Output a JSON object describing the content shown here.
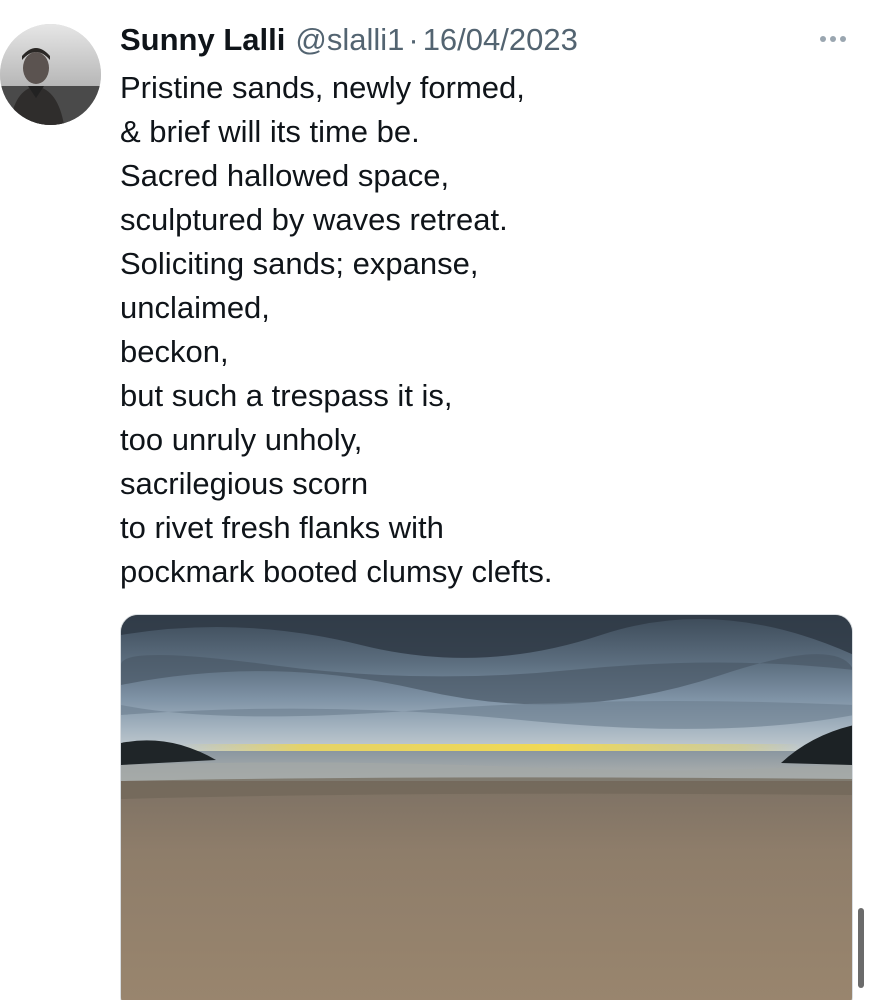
{
  "post": {
    "author": {
      "name": "Sunny Lalli",
      "handle": "@slalli1"
    },
    "separator": "·",
    "date": "16/04/2023",
    "text_lines": [
      "Pristine sands, newly formed,",
      "& brief will its time be.",
      "Sacred hallowed space,",
      "sculptured by waves retreat.",
      "Soliciting sands; expanse,",
      "unclaimed,",
      "beckon,",
      "but such a trespass it is,",
      "too unruly unholy,",
      "sacrilegious scorn",
      "to rivet fresh flanks with",
      "pockmark booted clumsy clefts."
    ],
    "more_icon": "more-horizontal-icon",
    "media_icon": "beach-photo"
  },
  "colors": {
    "text_primary": "#0f1419",
    "text_secondary": "#536471",
    "background": "#ffffff"
  }
}
